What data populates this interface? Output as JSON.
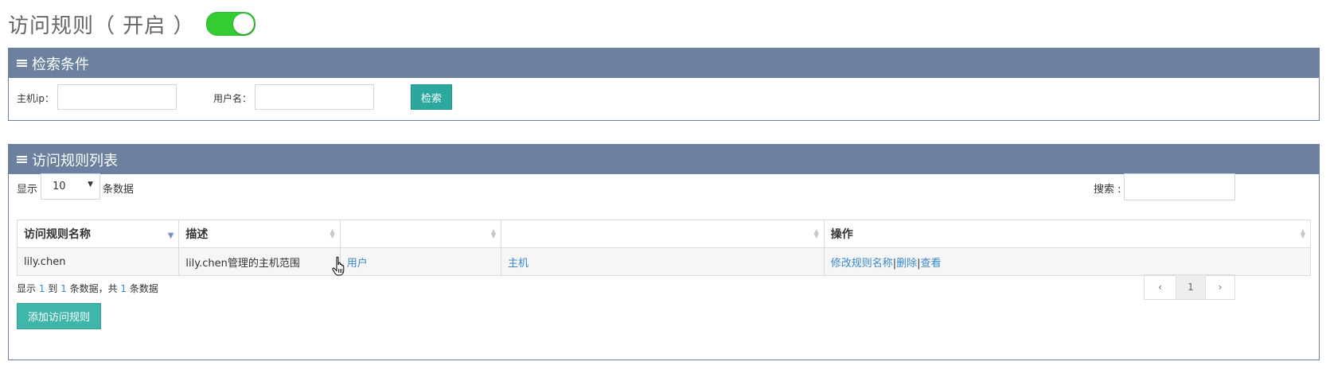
{
  "header": {
    "title": "访问规则（ 开启 ）",
    "toggle_on": true,
    "toggle_color": "#33cc33"
  },
  "search_panel": {
    "title": "检索条件",
    "host_ip_label": "主机ip：",
    "host_ip_value": "",
    "username_label": "用户名：",
    "username_value": "",
    "search_button": "检索"
  },
  "list_panel": {
    "title": "访问规则列表",
    "length_prefix": "显示",
    "length_value": "10",
    "length_suffix": "条数据",
    "search_label": "搜索 :",
    "search_value": "",
    "columns": [
      "访问规则名称",
      "描述",
      "",
      "",
      "操作"
    ],
    "rows": [
      {
        "name": "lily.chen",
        "desc": "lily.chen管理的主机范围",
        "users_link": "用户",
        "hosts_link": "主机",
        "actions": {
          "rename": "修改规则名称",
          "sep": "|",
          "delete": "删除",
          "view": "查看"
        }
      }
    ],
    "info": {
      "p1": "显示 ",
      "from": "1",
      "p2": " 到 ",
      "to": "1",
      "p3": " 条数据，共 ",
      "total": "1",
      "p4": " 条数据"
    },
    "pagination": {
      "prev": "‹",
      "current": "1",
      "next": "›"
    },
    "add_button": "添加访问规则"
  },
  "colors": {
    "panel_header": "#6b819f",
    "button": "#2aa89d",
    "link": "#3a87c8"
  }
}
